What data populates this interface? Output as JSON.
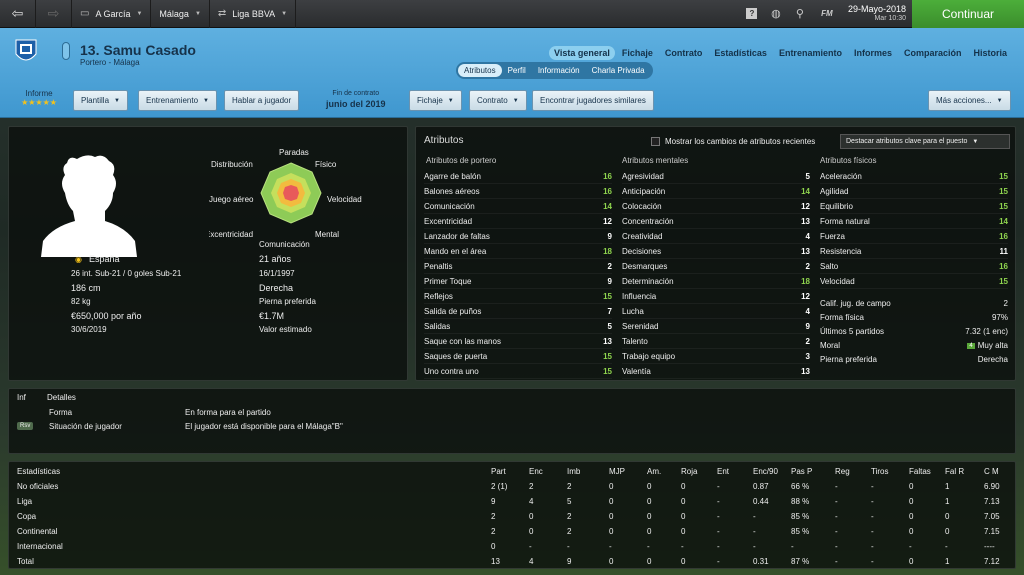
{
  "topbar": {
    "seg1": "A García",
    "seg2": "Málaga",
    "seg3": "Liga BBVA",
    "date": "29-Mayo-2018",
    "time": "Mar 10:30",
    "continue": "Continuar",
    "fm": "FM"
  },
  "header": {
    "name": "13. Samu Casado",
    "sub": "Portero - Málaga",
    "tabs": [
      "Vista general",
      "Fichaje",
      "Contrato",
      "Estadísticas",
      "Entrenamiento",
      "Informes",
      "Comparación",
      "Historia"
    ],
    "subtabs": [
      "Atributos",
      "Perfil",
      "Información",
      "Charla Privada"
    ],
    "informe": "Informe",
    "stars": "★★★★★",
    "buttons": {
      "plantilla": "Plantilla",
      "entrenamiento": "Entrenamiento",
      "hablar": "Hablar a jugador",
      "fichaje": "Fichaje",
      "contrato": "Contrato",
      "encontrar": "Encontrar jugadores similares",
      "mas": "Más acciones..."
    },
    "contract_label": "Fin de contrato",
    "contract_value": "junio del 2019"
  },
  "profile": {
    "nationality": "España",
    "age": "21 años",
    "caps": "26 int. Sub-21 / 0 goles Sub-21",
    "dob": "16/1/1997",
    "height": "186 cm",
    "foot": "Derecha",
    "weight": "82 kg",
    "foot_label": "Pierna preferida",
    "wage": "€650,000 por año",
    "value": "€1.7M",
    "expiry": "30/6/2019",
    "value_label": "Valor estimado",
    "radar": {
      "paradas": "Paradas",
      "fisico": "Físico",
      "distribucion": "Distribución",
      "juego_aereo": "Juego aéreo",
      "velocidad": "Velocidad",
      "excentricidad": "Excentricidad",
      "mental": "Mental",
      "comunicacion": "Comunicación"
    }
  },
  "attributes": {
    "title": "Atributos",
    "show_changes": "Mostrar los cambios de atributos recientes",
    "highlight": "Destacar atributos clave para el puesto",
    "gk_title": "Atributos de portero",
    "mental_title": "Atributos mentales",
    "phys_title": "Atributos físicos",
    "gk": [
      [
        "Agarre de balón",
        "16"
      ],
      [
        "Balones aéreos",
        "16"
      ],
      [
        "Comunicación",
        "14"
      ],
      [
        "Excentricidad",
        "12"
      ],
      [
        "Lanzador de faltas",
        "9"
      ],
      [
        "Mando en el área",
        "18"
      ],
      [
        "Penaltis",
        "2"
      ],
      [
        "Primer Toque",
        "9"
      ],
      [
        "Reflejos",
        "15"
      ],
      [
        "Salida de puños",
        "7"
      ],
      [
        "Salidas",
        "5"
      ],
      [
        "Saque con las manos",
        "13"
      ],
      [
        "Saques de puerta",
        "15"
      ],
      [
        "Uno contra uno",
        "15"
      ]
    ],
    "mental": [
      [
        "Agresividad",
        "5"
      ],
      [
        "Anticipación",
        "14"
      ],
      [
        "Colocación",
        "12"
      ],
      [
        "Concentración",
        "13"
      ],
      [
        "Creatividad",
        "4"
      ],
      [
        "Decisiones",
        "13"
      ],
      [
        "Desmarques",
        "2"
      ],
      [
        "Determinación",
        "18"
      ],
      [
        "Influencia",
        "12"
      ],
      [
        "Lucha",
        "4"
      ],
      [
        "Serenidad",
        "9"
      ],
      [
        "Talento",
        "2"
      ],
      [
        "Trabajo equipo",
        "3"
      ],
      [
        "Valentía",
        "13"
      ]
    ],
    "physical": [
      [
        "Aceleración",
        "15"
      ],
      [
        "Agilidad",
        "15"
      ],
      [
        "Equilibrio",
        "15"
      ],
      [
        "Forma natural",
        "14"
      ],
      [
        "Fuerza",
        "16"
      ],
      [
        "Resistencia",
        "11"
      ],
      [
        "Salto",
        "16"
      ],
      [
        "Velocidad",
        "15"
      ]
    ],
    "misc": [
      [
        "Calif. jug. de campo",
        "2"
      ],
      [
        "Forma física",
        "97%"
      ],
      [
        "Últimos 5 partidos",
        "7.32 (1 enc)"
      ],
      [
        "Moral",
        "Muy alta"
      ],
      [
        "Pierna preferida",
        "Derecha"
      ]
    ],
    "moral_badge": "4"
  },
  "details": {
    "col1": "Inf",
    "col2": "Detalles",
    "rows": [
      [
        "",
        "Forma",
        "En forma para el partido"
      ],
      [
        "Rsv",
        "Situación de jugador",
        "El jugador está disponible para el Málaga\"B\""
      ]
    ]
  },
  "stats": {
    "headers": [
      "Estadísticas",
      "Part",
      "Enc",
      "Imb",
      "MJP",
      "Am.",
      "Roja",
      "Ent",
      "Enc/90",
      "Pas P",
      "Reg",
      "Tiros",
      "Faltas",
      "Fal R",
      "C M"
    ],
    "rows": [
      [
        "No oficiales",
        "2 (1)",
        "2",
        "2",
        "0",
        "0",
        "0",
        "-",
        "0.87",
        "66 %",
        "-",
        "-",
        "0",
        "1",
        "6.90"
      ],
      [
        "Liga",
        "9",
        "4",
        "5",
        "0",
        "0",
        "0",
        "-",
        "0.44",
        "88 %",
        "-",
        "-",
        "0",
        "1",
        "7.13"
      ],
      [
        "Copa",
        "2",
        "0",
        "2",
        "0",
        "0",
        "0",
        "-",
        "-",
        "85 %",
        "-",
        "-",
        "0",
        "0",
        "7.05"
      ],
      [
        "Continental",
        "2",
        "0",
        "2",
        "0",
        "0",
        "0",
        "-",
        "-",
        "85 %",
        "-",
        "-",
        "0",
        "0",
        "7.15"
      ],
      [
        "Internacional",
        "0",
        "-",
        "-",
        "-",
        "-",
        "-",
        "-",
        "-",
        "-",
        "-",
        "-",
        "-",
        "-",
        "----"
      ],
      [
        "Total",
        "13",
        "4",
        "9",
        "0",
        "0",
        "0",
        "-",
        "0.31",
        "87 %",
        "-",
        "-",
        "0",
        "1",
        "7.12"
      ]
    ]
  }
}
